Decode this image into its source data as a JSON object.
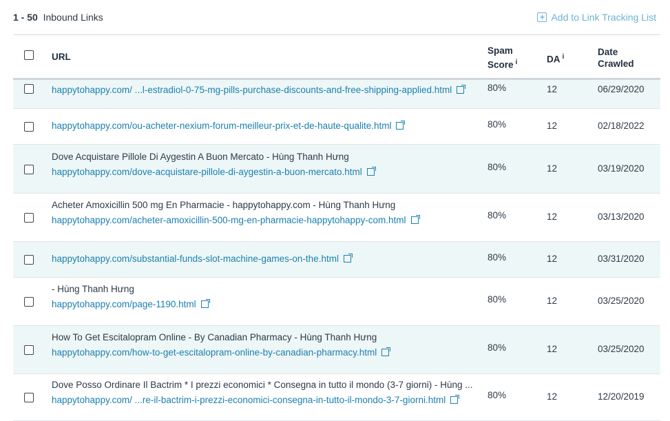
{
  "summary": {
    "range": "1 - 50",
    "label": "Inbound Links"
  },
  "actions": {
    "add_tracking": "Add to Link Tracking List"
  },
  "columns": {
    "url": "URL",
    "spam_1": "Spam",
    "spam_2": "Score",
    "da": "DA",
    "date_1": "Date",
    "date_2": "Crawled",
    "info": "i"
  },
  "rows": [
    {
      "title": "",
      "url": "happytohappy.com/ ...l-estradiol-0-75-mg-pills-purchase-discounts-and-free-shipping-applied.html",
      "spam": "80%",
      "da": "12",
      "date": "06/29/2020"
    },
    {
      "title": "",
      "url": "happytohappy.com/ou-acheter-nexium-forum-meilleur-prix-et-de-haute-qualite.html",
      "spam": "80%",
      "da": "12",
      "date": "02/18/2022"
    },
    {
      "title": "Dove Acquistare Pillole Di Aygestin A Buon Mercato - Hùng Thanh Hưng",
      "url": "happytohappy.com/dove-acquistare-pillole-di-aygestin-a-buon-mercato.html",
      "spam": "80%",
      "da": "12",
      "date": "03/19/2020"
    },
    {
      "title": "Acheter Amoxicillin 500 mg En Pharmacie - happytohappy.com - Hùng Thanh Hưng",
      "url": "happytohappy.com/acheter-amoxicillin-500-mg-en-pharmacie-happytohappy-com.html",
      "spam": "80%",
      "da": "12",
      "date": "03/13/2020"
    },
    {
      "title": "",
      "url": "happytohappy.com/substantial-funds-slot-machine-games-on-the.html",
      "spam": "80%",
      "da": "12",
      "date": "03/31/2020"
    },
    {
      "title": "- Hùng Thanh Hưng",
      "url": "happytohappy.com/page-1190.html",
      "spam": "80%",
      "da": "12",
      "date": "03/25/2020"
    },
    {
      "title": "How To Get Escitalopram Online - By Canadian Pharmacy - Hùng Thanh Hưng",
      "url": "happytohappy.com/how-to-get-escitalopram-online-by-canadian-pharmacy.html",
      "spam": "80%",
      "da": "12",
      "date": "03/25/2020"
    },
    {
      "title": "Dove Posso Ordinare Il Bactrim * I prezzi economici * Consegna in tutto il mondo (3-7 giorni) - Hùng ...",
      "url": "happytohappy.com/ ...re-il-bactrim-i-prezzi-economici-consegna-in-tutto-il-mondo-3-7-giorni.html",
      "spam": "80%",
      "da": "12",
      "date": "12/20/2019"
    }
  ]
}
